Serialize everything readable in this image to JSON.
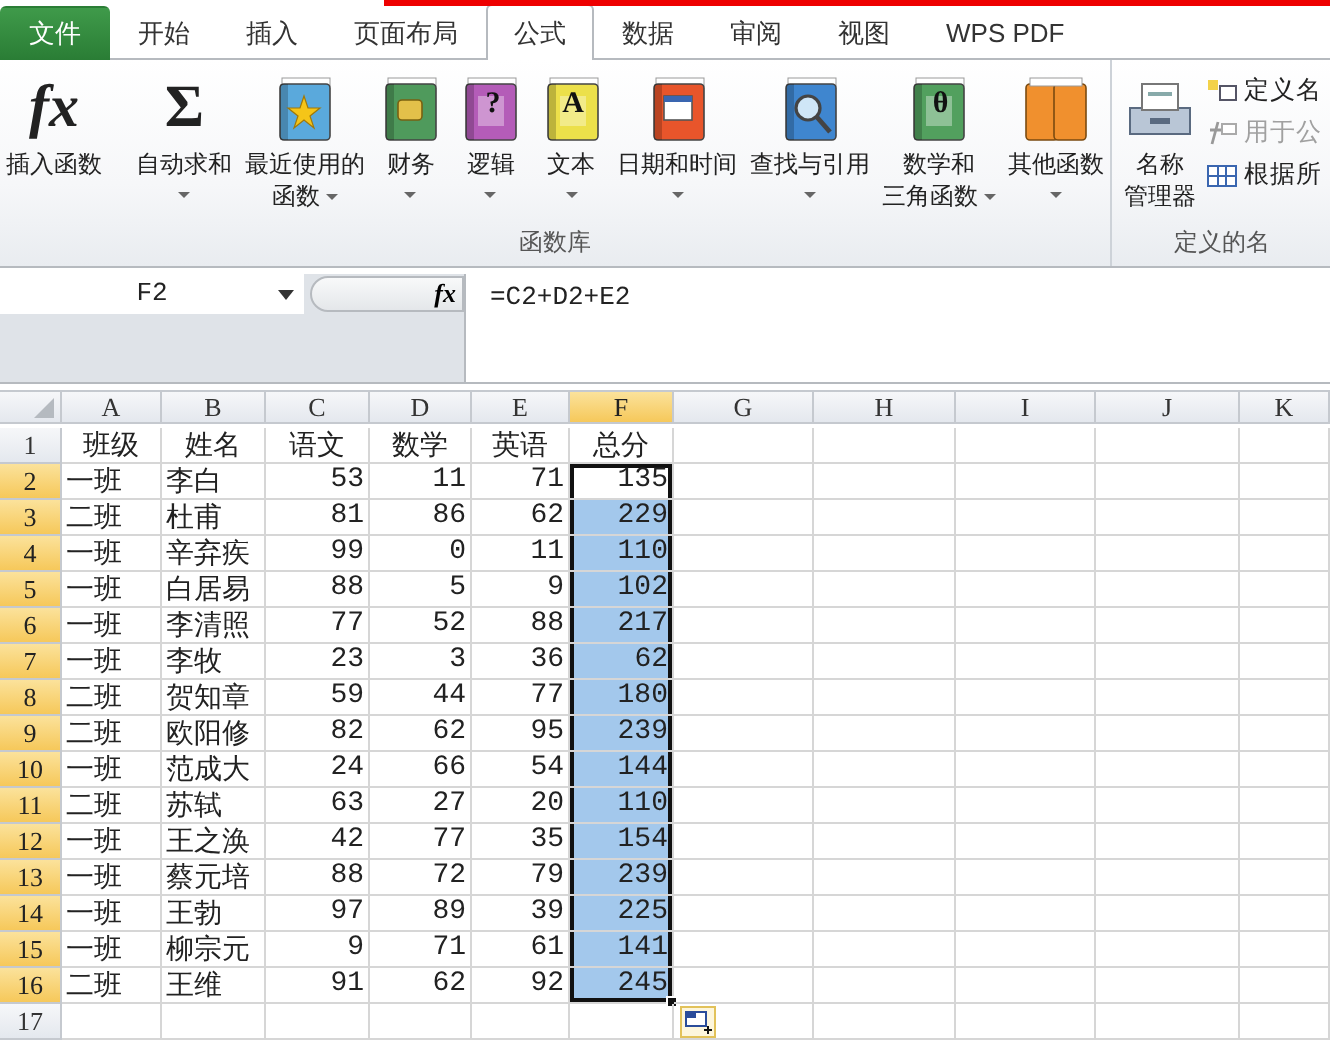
{
  "tabs": [
    {
      "label": "文件",
      "kind": "file",
      "selected": false
    },
    {
      "label": "开始",
      "kind": "tab",
      "selected": false
    },
    {
      "label": "插入",
      "kind": "tab",
      "selected": false
    },
    {
      "label": "页面布局",
      "kind": "tab",
      "selected": false
    },
    {
      "label": "公式",
      "kind": "tab",
      "selected": true
    },
    {
      "label": "数据",
      "kind": "tab",
      "selected": false
    },
    {
      "label": "审阅",
      "kind": "tab",
      "selected": false
    },
    {
      "label": "视图",
      "kind": "tab",
      "selected": false
    },
    {
      "label": "WPS PDF",
      "kind": "tab",
      "selected": false
    }
  ],
  "ribbon": {
    "function_library": {
      "label": "函数库",
      "buttons": [
        {
          "lines": [
            "插入函数"
          ],
          "kind": "glyph",
          "glyph": "fx",
          "dropdown": false
        },
        {
          "lines": [
            "自动求和"
          ],
          "kind": "glyph",
          "glyph": "Σ",
          "dropdown": true
        },
        {
          "lines": [
            "最近使用的",
            "函数"
          ],
          "kind": "book",
          "dropdown": true
        },
        {
          "lines": [
            "财务"
          ],
          "kind": "book",
          "dropdown": true
        },
        {
          "lines": [
            "逻辑"
          ],
          "kind": "book",
          "glyph": "?",
          "dropdown": true
        },
        {
          "lines": [
            "文本"
          ],
          "kind": "book",
          "glyph": "A",
          "dropdown": true
        },
        {
          "lines": [
            "日期和时间"
          ],
          "kind": "book",
          "dropdown": true
        },
        {
          "lines": [
            "查找与引用"
          ],
          "kind": "book",
          "dropdown": true
        },
        {
          "lines": [
            "数学和",
            "三角函数"
          ],
          "kind": "book",
          "glyph": "θ",
          "dropdown": true
        },
        {
          "lines": [
            "其他函数"
          ],
          "kind": "books",
          "dropdown": true
        }
      ]
    },
    "defined_names": {
      "label": "定义的名",
      "manager": {
        "lines": [
          "名称",
          "管理器"
        ]
      },
      "small_buttons": [
        {
          "label": "定义名",
          "disabled": false
        },
        {
          "label": "用于公",
          "disabled": true
        },
        {
          "label": "根据所",
          "disabled": false
        }
      ]
    }
  },
  "formula_bar": {
    "name_box": "F2",
    "function_glyph": "fx",
    "formula": "=C2+D2+E2"
  },
  "sheet": {
    "columns": [
      {
        "label": "A",
        "selected": false
      },
      {
        "label": "B",
        "selected": false
      },
      {
        "label": "C",
        "selected": false
      },
      {
        "label": "D",
        "selected": false
      },
      {
        "label": "E",
        "selected": false
      },
      {
        "label": "F",
        "selected": true
      },
      {
        "label": "G",
        "selected": false
      },
      {
        "label": "H",
        "selected": false
      },
      {
        "label": "I",
        "selected": false
      },
      {
        "label": "J",
        "selected": false
      },
      {
        "label": "K",
        "selected": false
      }
    ],
    "rows": [
      {
        "header": "1",
        "kind": "heading",
        "selected": false,
        "total_highlighted": false,
        "active": false,
        "cells": [
          "班级",
          "姓名",
          "语文",
          "数学",
          "英语",
          "总分"
        ]
      },
      {
        "header": "2",
        "kind": "data",
        "selected": true,
        "total_highlighted": false,
        "active": true,
        "cells": [
          "一班",
          "李白",
          "53",
          "11",
          "71",
          "135"
        ]
      },
      {
        "header": "3",
        "kind": "data",
        "selected": true,
        "total_highlighted": true,
        "active": false,
        "cells": [
          "二班",
          "杜甫",
          "81",
          "86",
          "62",
          "229"
        ]
      },
      {
        "header": "4",
        "kind": "data",
        "selected": true,
        "total_highlighted": true,
        "active": false,
        "cells": [
          "一班",
          "辛弃疾",
          "99",
          "0",
          "11",
          "110"
        ]
      },
      {
        "header": "5",
        "kind": "data",
        "selected": true,
        "total_highlighted": true,
        "active": false,
        "cells": [
          "一班",
          "白居易",
          "88",
          "5",
          "9",
          "102"
        ]
      },
      {
        "header": "6",
        "kind": "data",
        "selected": true,
        "total_highlighted": true,
        "active": false,
        "cells": [
          "一班",
          "李清照",
          "77",
          "52",
          "88",
          "217"
        ]
      },
      {
        "header": "7",
        "kind": "data",
        "selected": true,
        "total_highlighted": true,
        "active": false,
        "cells": [
          "一班",
          "李牧",
          "23",
          "3",
          "36",
          "62"
        ]
      },
      {
        "header": "8",
        "kind": "data",
        "selected": true,
        "total_highlighted": true,
        "active": false,
        "cells": [
          "二班",
          "贺知章",
          "59",
          "44",
          "77",
          "180"
        ]
      },
      {
        "header": "9",
        "kind": "data",
        "selected": true,
        "total_highlighted": true,
        "active": false,
        "cells": [
          "二班",
          "欧阳修",
          "82",
          "62",
          "95",
          "239"
        ]
      },
      {
        "header": "10",
        "kind": "data",
        "selected": true,
        "total_highlighted": true,
        "active": false,
        "cells": [
          "一班",
          "范成大",
          "24",
          "66",
          "54",
          "144"
        ]
      },
      {
        "header": "11",
        "kind": "data",
        "selected": true,
        "total_highlighted": true,
        "active": false,
        "cells": [
          "二班",
          "苏轼",
          "63",
          "27",
          "20",
          "110"
        ]
      },
      {
        "header": "12",
        "kind": "data",
        "selected": true,
        "total_highlighted": true,
        "active": false,
        "cells": [
          "一班",
          "王之涣",
          "42",
          "77",
          "35",
          "154"
        ]
      },
      {
        "header": "13",
        "kind": "data",
        "selected": true,
        "total_highlighted": true,
        "active": false,
        "cells": [
          "一班",
          "蔡元培",
          "88",
          "72",
          "79",
          "239"
        ]
      },
      {
        "header": "14",
        "kind": "data",
        "selected": true,
        "total_highlighted": true,
        "active": false,
        "cells": [
          "一班",
          "王勃",
          "97",
          "89",
          "39",
          "225"
        ]
      },
      {
        "header": "15",
        "kind": "data",
        "selected": true,
        "total_highlighted": true,
        "active": false,
        "cells": [
          "一班",
          "柳宗元",
          "9",
          "71",
          "61",
          "141"
        ]
      },
      {
        "header": "16",
        "kind": "data",
        "selected": true,
        "total_highlighted": true,
        "active": false,
        "cells": [
          "二班",
          "王维",
          "91",
          "62",
          "92",
          "245"
        ]
      },
      {
        "header": "17",
        "kind": "data",
        "selected": false,
        "total_highlighted": false,
        "active": false
      }
    ]
  }
}
